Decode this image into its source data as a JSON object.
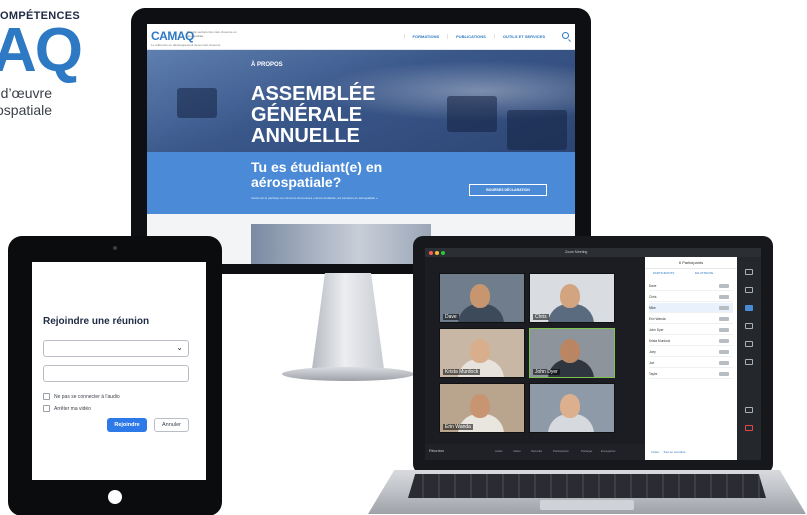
{
  "brand": {
    "kicker": "OMPÉTENCES",
    "letters": "AQ",
    "line1": "-d’œuvre",
    "line2": "ospatiale"
  },
  "website": {
    "logo": "CAMAQ",
    "logo_sub": "Comité sectoriel de main-d'oeuvre en aérospatiale",
    "tagline": "Le référence en développement de la main-d'oeuvre",
    "nav": [
      "FORMATIONS",
      "PUBLICATIONS",
      "OUTILS ET SERVICES"
    ],
    "hero_kicker": "À PROPOS",
    "hero_title": "ASSEMBLÉE GÉNÉRALE ANNUELLE",
    "band_heading": "Tu es étudiant(e) en aérospatiale?",
    "band_text": "Inscris-toi et participe au concours de bourses « Entre étudiants, les carrières en aérospatiale »",
    "band_button": "BOURSES DÉCLARATION"
  },
  "meeting_form": {
    "title": "Rejoindre une réunion",
    "select_value": "",
    "name_value": "",
    "checkbox_audio": "Ne pas se connecter à l'audio",
    "checkbox_video": "Arrêter ma vidéo",
    "join_button": "Rejoindre",
    "cancel_button": "Annuler",
    "audio_checked": false,
    "video_checked": false
  },
  "video_call": {
    "window_title": "Zoom Meeting",
    "app_name": "Réunion",
    "participants_header": "6 Participants",
    "participants_tabs": [
      "PARTICIPANTS",
      "EN ATTENTE"
    ],
    "tiles": [
      {
        "name": "Dave",
        "active": false
      },
      {
        "name": "Chris",
        "active": false
      },
      {
        "name": "Krista Murdock",
        "active": false
      },
      {
        "name": "John Dyer",
        "active": true
      },
      {
        "name": "Erin Wanda",
        "active": false
      },
      {
        "name": "",
        "active": false
      }
    ],
    "participants": [
      "Dave",
      "Chris",
      "Mike",
      "Erin Wanda",
      "John Dyer",
      "Krista Murdock",
      "Joey",
      "Joe",
      "Taylor"
    ],
    "highlighted_participant": "Mike",
    "panel_footer": [
      "Inviter",
      "Tout en sourdine"
    ],
    "controls": [
      "Audio",
      "Vidéo",
      "Sécurité",
      "Participants",
      "Partager",
      "Enregistrer",
      "Réactions"
    ],
    "colors": {
      "accent": "#4a8ad6",
      "active_speaker": "#7ec34b",
      "dark": "#1b1d22"
    }
  }
}
